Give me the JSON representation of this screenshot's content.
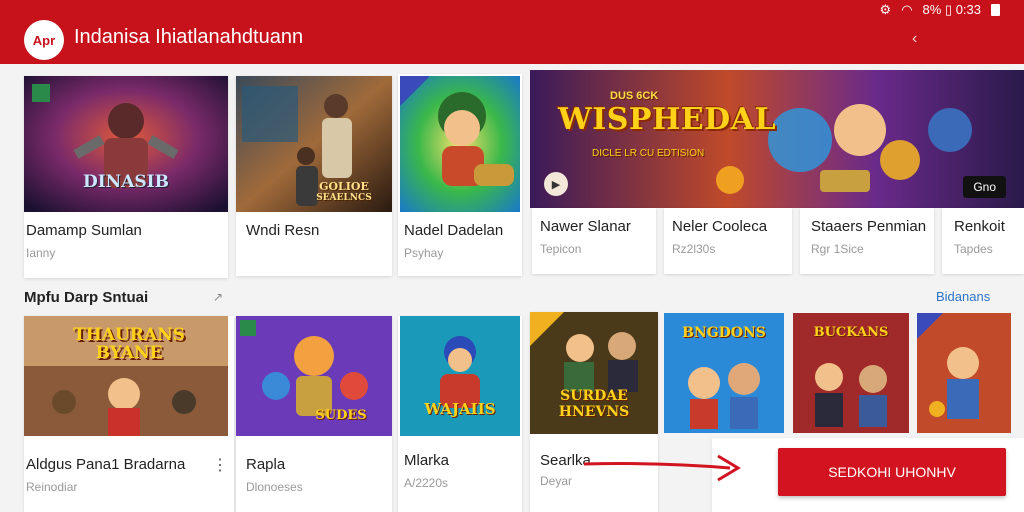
{
  "header": {
    "logo_text": "Apr",
    "title": "Indanisa Ihiatlanahdtuann",
    "status_text": "8% ▯ 0:33",
    "back_icon": "chevron-left-icon"
  },
  "featured": [
    {
      "title": "Damamp Sumlan",
      "subtitle": "Ianny",
      "art_text": "DINASIB",
      "colors": [
        "#2b1a3a",
        "#c0392b",
        "#4a2a6a"
      ]
    },
    {
      "title": "Wndi Resn",
      "subtitle": "",
      "art_text": "GOLIOE",
      "art_text2": "SEAELNCS",
      "colors": [
        "#3a2a1a",
        "#9c6b3a",
        "#2a4a5a"
      ]
    },
    {
      "title": "Nadel Dadelan",
      "subtitle": "Psyhay",
      "colors": [
        "#1e6a2a",
        "#1a9ad8",
        "#e0a030"
      ]
    },
    {
      "title": "Nawer Slanar",
      "subtitle": "Tepicon",
      "colors": []
    },
    {
      "title": "Neler Cooleca",
      "subtitle": "Rz2l30s",
      "colors": []
    },
    {
      "title": "Staaers Penmian",
      "subtitle": "Rgr 1Sice",
      "colors": []
    },
    {
      "title": "Renkoit",
      "subtitle": "Tapdes",
      "colors": []
    }
  ],
  "banner": {
    "small_text": "DUS 6CK",
    "title": "WISPHEDAL",
    "subtitle": "DICLE LR CU EDTISION",
    "tag": "Gno"
  },
  "section": {
    "title": "Mpfu Darp Sntuai",
    "link": "Bidanans"
  },
  "games": [
    {
      "title": "Aldgus Pana1 Bradarna",
      "subtitle": "Reinodiar",
      "art_text": "THAURANS BYANE"
    },
    {
      "title": "Rapla",
      "subtitle": "Dlonoeses",
      "art_text": "SUDES"
    },
    {
      "title": "Mlarka",
      "subtitle": "A/2220s",
      "art_text": "WAJAIIS"
    },
    {
      "title": "Searlka",
      "subtitle": "Deyar",
      "art_text": "SURDAE HNEVNS"
    },
    {
      "title": "",
      "subtitle": "",
      "art_text": "BNGDONS"
    },
    {
      "title": "",
      "subtitle": "",
      "art_text": "BUCKANS"
    },
    {
      "title": "",
      "subtitle": "",
      "art_text": ""
    }
  ],
  "cta": {
    "label": "SEDKOHI UHONHV"
  },
  "accent": "#c8121b"
}
